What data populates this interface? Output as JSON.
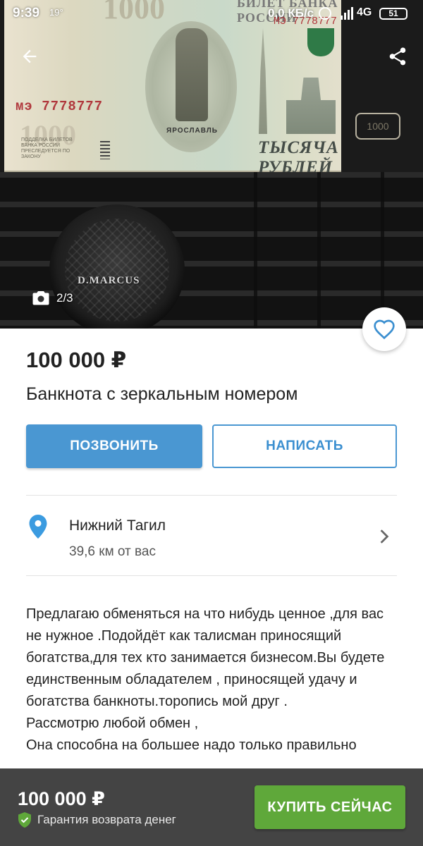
{
  "status_bar": {
    "time": "9:39",
    "temperature": "19°",
    "net_speed": "0,0 КБ/с",
    "network": "4G",
    "battery": "51"
  },
  "gallery": {
    "counter": "2/3",
    "photo": {
      "serial": "мэ 7778777",
      "serial_top": "МЭ 7778777",
      "value": "1000",
      "bank": "БИЛЕТ БАНКА РОССИИ",
      "small_text": "ПОДДЕЛКА БИЛЕТОВ БАНКА РОССИИ ПРЕСЛЕДУЕТСЯ ПО ЗАКОНУ",
      "city": "ЯРОСЛАВЛЬ",
      "words": "ТЫСЯЧА РУБЛЕЙ",
      "knob_logo": "D.MARCUS"
    }
  },
  "listing": {
    "price": "100 000 ₽",
    "title": "Банкнота с зеркальным номером"
  },
  "actions": {
    "call_label": "ПОЗВОНИТЬ",
    "write_label": "НАПИСАТЬ"
  },
  "location": {
    "city": "Нижний Тагил",
    "distance": "39,6 км от вас"
  },
  "description": {
    "lines": [
      "Предлагаю обменяться на что нибудь ценное ,для вас не нужное .Подойдёт как талисман приносящий богатства,для тех кто занимается бизнесом.Вы будете единственным обладателем , приносящей удачу и богатства банкноты.торопись мой друг .",
      "Рассмотрю любой обмен ,",
      "Она способна на большее надо только правильно"
    ]
  },
  "bottom_bar": {
    "price": "100 000 ₽",
    "guarantee": "Гарантия возврата денег",
    "buy_label": "КУПИТЬ СЕЙЧАС"
  },
  "colors": {
    "call_button": "#4a97d2",
    "buy_button": "#5fa83a",
    "bottom_bar": "#444444",
    "pin": "#3b9be0"
  },
  "icons": [
    "back-arrow-icon",
    "share-icon",
    "camera-icon",
    "heart-icon",
    "location-pin-icon",
    "chevron-right-icon",
    "shield-check-icon"
  ]
}
